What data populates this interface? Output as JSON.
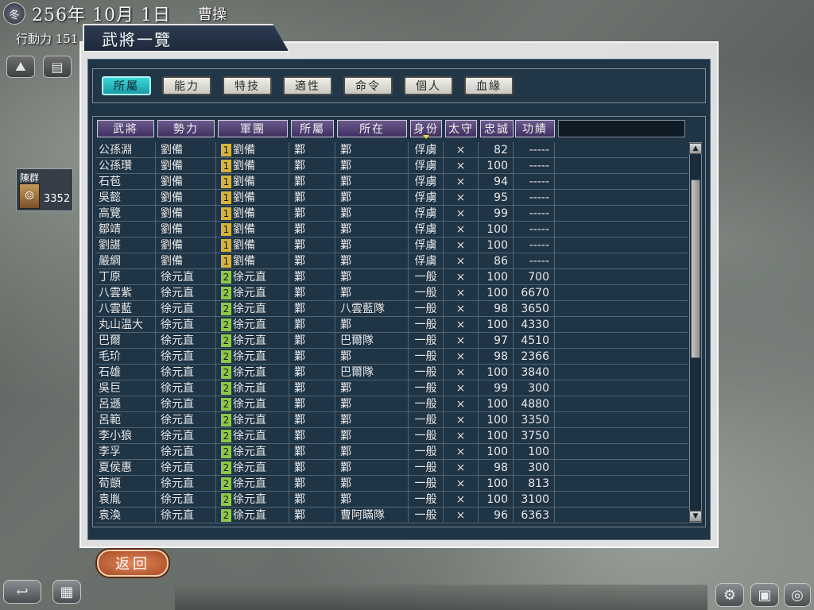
{
  "hud": {
    "season_icon": "冬",
    "date": "256年 10月 1日",
    "ruler": "曹操",
    "action_points": "行動力 151"
  },
  "side_card": {
    "name": "陳群",
    "troops": "3352"
  },
  "window": {
    "title": "武將一覽"
  },
  "tabs": [
    {
      "label": "所屬",
      "active": true
    },
    {
      "label": "能力"
    },
    {
      "label": "特技"
    },
    {
      "label": "適性"
    },
    {
      "label": "命令"
    },
    {
      "label": "個人"
    },
    {
      "label": "血緣"
    }
  ],
  "columns": [
    "武將",
    "勢力",
    "軍團",
    "所屬",
    "所在",
    "身份",
    "太守",
    "忠誠",
    "功績"
  ],
  "rows": [
    {
      "name": "公孫淵",
      "force": "劉備",
      "corps_no": "1",
      "corps": "劉備",
      "city": "鄴",
      "loc": "鄴",
      "status": "俘虜",
      "gov": "×",
      "loyalty": "82",
      "merit": "-----"
    },
    {
      "name": "公孫瓚",
      "force": "劉備",
      "corps_no": "1",
      "corps": "劉備",
      "city": "鄴",
      "loc": "鄴",
      "status": "俘虜",
      "gov": "×",
      "loyalty": "100",
      "merit": "-----"
    },
    {
      "name": "石苞",
      "force": "劉備",
      "corps_no": "1",
      "corps": "劉備",
      "city": "鄴",
      "loc": "鄴",
      "status": "俘虜",
      "gov": "×",
      "loyalty": "94",
      "merit": "-----"
    },
    {
      "name": "吳懿",
      "force": "劉備",
      "corps_no": "1",
      "corps": "劉備",
      "city": "鄴",
      "loc": "鄴",
      "status": "俘虜",
      "gov": "×",
      "loyalty": "95",
      "merit": "-----"
    },
    {
      "name": "高覽",
      "force": "劉備",
      "corps_no": "1",
      "corps": "劉備",
      "city": "鄴",
      "loc": "鄴",
      "status": "俘虜",
      "gov": "×",
      "loyalty": "99",
      "merit": "-----"
    },
    {
      "name": "鄒靖",
      "force": "劉備",
      "corps_no": "1",
      "corps": "劉備",
      "city": "鄴",
      "loc": "鄴",
      "status": "俘虜",
      "gov": "×",
      "loyalty": "100",
      "merit": "-----"
    },
    {
      "name": "劉諶",
      "force": "劉備",
      "corps_no": "1",
      "corps": "劉備",
      "city": "鄴",
      "loc": "鄴",
      "status": "俘虜",
      "gov": "×",
      "loyalty": "100",
      "merit": "-----"
    },
    {
      "name": "嚴綱",
      "force": "劉備",
      "corps_no": "1",
      "corps": "劉備",
      "city": "鄴",
      "loc": "鄴",
      "status": "俘虜",
      "gov": "×",
      "loyalty": "86",
      "merit": "-----"
    },
    {
      "name": "丁原",
      "force": "徐元直",
      "corps_no": "2",
      "corps": "徐元直",
      "city": "鄴",
      "loc": "鄴",
      "status": "一般",
      "gov": "×",
      "loyalty": "100",
      "merit": "700"
    },
    {
      "name": "八雲紫",
      "force": "徐元直",
      "corps_no": "2",
      "corps": "徐元直",
      "city": "鄴",
      "loc": "鄴",
      "status": "一般",
      "gov": "×",
      "loyalty": "100",
      "merit": "6670"
    },
    {
      "name": "八雲藍",
      "force": "徐元直",
      "corps_no": "2",
      "corps": "徐元直",
      "city": "鄴",
      "loc": "八雲藍隊",
      "status": "一般",
      "gov": "×",
      "loyalty": "98",
      "merit": "3650"
    },
    {
      "name": "丸山温大",
      "force": "徐元直",
      "corps_no": "2",
      "corps": "徐元直",
      "city": "鄴",
      "loc": "鄴",
      "status": "一般",
      "gov": "×",
      "loyalty": "100",
      "merit": "4330"
    },
    {
      "name": "巴爾",
      "force": "徐元直",
      "corps_no": "2",
      "corps": "徐元直",
      "city": "鄴",
      "loc": "巴爾隊",
      "status": "一般",
      "gov": "×",
      "loyalty": "97",
      "merit": "4510"
    },
    {
      "name": "毛玠",
      "force": "徐元直",
      "corps_no": "2",
      "corps": "徐元直",
      "city": "鄴",
      "loc": "鄴",
      "status": "一般",
      "gov": "×",
      "loyalty": "98",
      "merit": "2366"
    },
    {
      "name": "石雄",
      "force": "徐元直",
      "corps_no": "2",
      "corps": "徐元直",
      "city": "鄴",
      "loc": "巴爾隊",
      "status": "一般",
      "gov": "×",
      "loyalty": "100",
      "merit": "3840"
    },
    {
      "name": "吳巨",
      "force": "徐元直",
      "corps_no": "2",
      "corps": "徐元直",
      "city": "鄴",
      "loc": "鄴",
      "status": "一般",
      "gov": "×",
      "loyalty": "99",
      "merit": "300"
    },
    {
      "name": "呂遜",
      "force": "徐元直",
      "corps_no": "2",
      "corps": "徐元直",
      "city": "鄴",
      "loc": "鄴",
      "status": "一般",
      "gov": "×",
      "loyalty": "100",
      "merit": "4880"
    },
    {
      "name": "呂範",
      "force": "徐元直",
      "corps_no": "2",
      "corps": "徐元直",
      "city": "鄴",
      "loc": "鄴",
      "status": "一般",
      "gov": "×",
      "loyalty": "100",
      "merit": "3350"
    },
    {
      "name": "李小狼",
      "force": "徐元直",
      "corps_no": "2",
      "corps": "徐元直",
      "city": "鄴",
      "loc": "鄴",
      "status": "一般",
      "gov": "×",
      "loyalty": "100",
      "merit": "3750"
    },
    {
      "name": "李孚",
      "force": "徐元直",
      "corps_no": "2",
      "corps": "徐元直",
      "city": "鄴",
      "loc": "鄴",
      "status": "一般",
      "gov": "×",
      "loyalty": "100",
      "merit": "100"
    },
    {
      "name": "夏侯惠",
      "force": "徐元直",
      "corps_no": "2",
      "corps": "徐元直",
      "city": "鄴",
      "loc": "鄴",
      "status": "一般",
      "gov": "×",
      "loyalty": "98",
      "merit": "300"
    },
    {
      "name": "荀顗",
      "force": "徐元直",
      "corps_no": "2",
      "corps": "徐元直",
      "city": "鄴",
      "loc": "鄴",
      "status": "一般",
      "gov": "×",
      "loyalty": "100",
      "merit": "813"
    },
    {
      "name": "袁胤",
      "force": "徐元直",
      "corps_no": "2",
      "corps": "徐元直",
      "city": "鄴",
      "loc": "鄴",
      "status": "一般",
      "gov": "×",
      "loyalty": "100",
      "merit": "3100"
    },
    {
      "name": "袁渙",
      "force": "徐元直",
      "corps_no": "2",
      "corps": "徐元直",
      "city": "鄴",
      "loc": "曹阿瞞隊",
      "status": "一般",
      "gov": "×",
      "loyalty": "96",
      "merit": "6363"
    }
  ],
  "scroll": {
    "up_icon": "▲",
    "down_icon": "▼"
  },
  "back_label": "返回"
}
